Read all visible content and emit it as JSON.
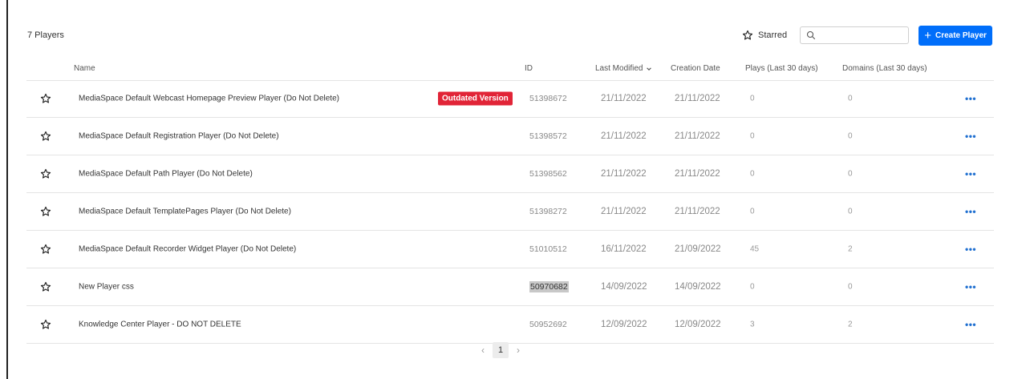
{
  "summary": {
    "count_label": "7 Players"
  },
  "toolbar": {
    "starred_label": "Starred",
    "search_placeholder": "",
    "search_value": "",
    "create_label": "Create Player",
    "accent_color": "#006efa"
  },
  "columns": {
    "name": "Name",
    "id": "ID",
    "last_modified": "Last Modified",
    "creation_date": "Creation Date",
    "plays": "Plays (Last 30 days)",
    "domains": "Domains (Last 30 days)"
  },
  "rows": [
    {
      "name": "MediaSpace Default Webcast Homepage Preview Player (Do Not Delete)",
      "badge": "Outdated Version",
      "id": "51398672",
      "last_modified": "21/11/2022",
      "created": "21/11/2022",
      "plays": "0",
      "domains": "0",
      "menu": "•••"
    },
    {
      "name": "MediaSpace Default Registration Player (Do Not Delete)",
      "badge": "",
      "id": "51398572",
      "last_modified": "21/11/2022",
      "created": "21/11/2022",
      "plays": "0",
      "domains": "0",
      "menu": "•••"
    },
    {
      "name": "MediaSpace Default Path Player (Do Not Delete)",
      "badge": "",
      "id": "51398562",
      "last_modified": "21/11/2022",
      "created": "21/11/2022",
      "plays": "0",
      "domains": "0",
      "menu": "•••"
    },
    {
      "name": "MediaSpace Default TemplatePages Player (Do Not Delete)",
      "badge": "",
      "id": "51398272",
      "last_modified": "21/11/2022",
      "created": "21/11/2022",
      "plays": "0",
      "domains": "0",
      "menu": "•••"
    },
    {
      "name": "MediaSpace Default Recorder Widget Player (Do Not Delete)",
      "badge": "",
      "id": "51010512",
      "last_modified": "16/11/2022",
      "created": "21/09/2022",
      "plays": "45",
      "domains": "2",
      "menu": "•••"
    },
    {
      "name": "New Player css",
      "badge": "",
      "id": "50970682",
      "last_modified": "14/09/2022",
      "created": "14/09/2022",
      "plays": "0",
      "domains": "0",
      "menu": "•••"
    },
    {
      "name": "Knowledge Center Player - DO NOT DELETE",
      "badge": "",
      "id": "50952692",
      "last_modified": "12/09/2022",
      "created": "12/09/2022",
      "plays": "3",
      "domains": "2",
      "menu": "•••"
    }
  ],
  "pagination": {
    "prev": "‹",
    "current": "1",
    "next": "›"
  },
  "icons": {
    "star": "star-outline-icon",
    "search": "search-icon",
    "plus": "plus-icon",
    "sort": "chevron-down-icon"
  }
}
